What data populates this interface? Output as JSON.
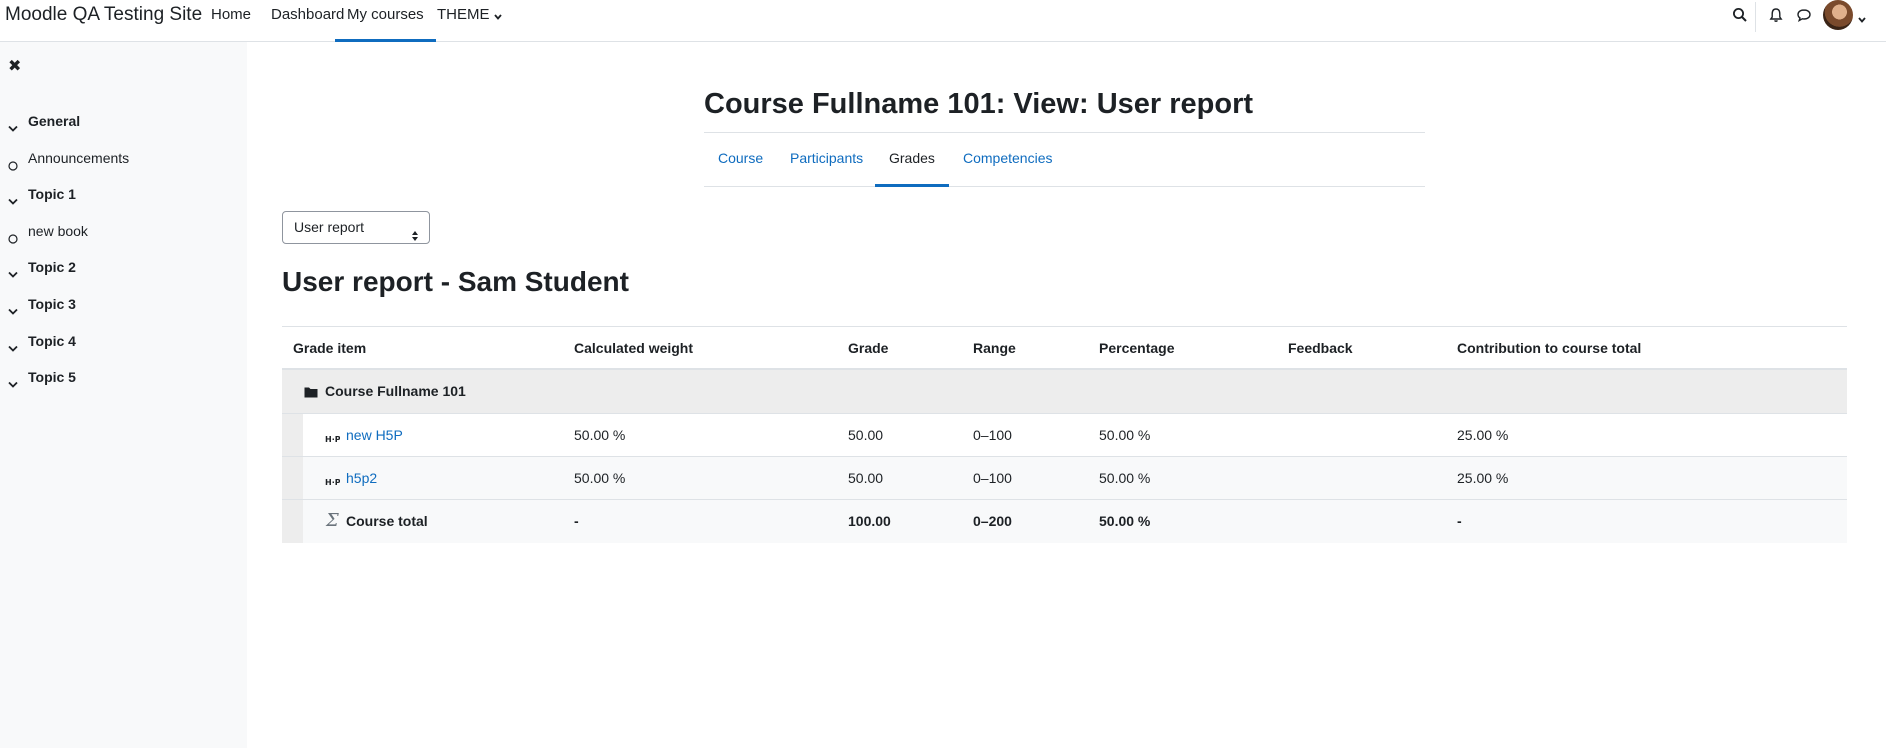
{
  "site": {
    "name": "Moodle QA Testing Site"
  },
  "primary_nav": [
    {
      "label": "Home"
    },
    {
      "label": "Dashboard"
    },
    {
      "label": "My courses",
      "active": true
    },
    {
      "label": "THEME"
    }
  ],
  "nav_right_icons": [
    "search-icon",
    "bell-icon",
    "chat-icon",
    "avatar"
  ],
  "drawer": {
    "close_icon": "close-icon",
    "items": [
      {
        "label": "General",
        "type": "section"
      },
      {
        "label": "Announcements",
        "type": "activity"
      },
      {
        "label": "Topic 1",
        "type": "section"
      },
      {
        "label": "new book",
        "type": "activity"
      },
      {
        "label": "Topic 2",
        "type": "section"
      },
      {
        "label": "Topic 3",
        "type": "section"
      },
      {
        "label": "Topic 4",
        "type": "section"
      },
      {
        "label": "Topic 5",
        "type": "section"
      }
    ]
  },
  "page": {
    "title": "Course Fullname 101: View: User report",
    "secondary_nav": [
      {
        "label": "Course"
      },
      {
        "label": "Participants"
      },
      {
        "label": "Grades",
        "active": true
      },
      {
        "label": "Competencies"
      }
    ],
    "report_select": {
      "value": "User report"
    },
    "report_heading": "User report - Sam Student"
  },
  "grade_table": {
    "headers": [
      "Grade item",
      "Calculated weight",
      "Grade",
      "Range",
      "Percentage",
      "Feedback",
      "Contribution to course total"
    ],
    "category": {
      "name": "Course Fullname 101",
      "icon": "folder-icon"
    },
    "items": [
      {
        "name": "new H5P",
        "icon": "h5p-icon",
        "weight": "50.00 %",
        "grade": "50.00",
        "range": "0–100",
        "percentage": "50.00 %",
        "feedback": "",
        "contribution": "25.00 %"
      },
      {
        "name": "h5p2",
        "icon": "h5p-icon",
        "weight": "50.00 %",
        "grade": "50.00",
        "range": "0–100",
        "percentage": "50.00 %",
        "feedback": "",
        "contribution": "25.00 %"
      }
    ],
    "total": {
      "name": "Course total",
      "icon": "sigma-icon",
      "weight": "-",
      "grade": "100.00",
      "range": "0–200",
      "percentage": "50.00 %",
      "feedback": "",
      "contribution": "-"
    }
  },
  "colors": {
    "link": "#0f6cbf",
    "active_underline": "#0f6cbf",
    "drawer_bg": "#f8f9fa",
    "category_bg": "#ededed"
  }
}
